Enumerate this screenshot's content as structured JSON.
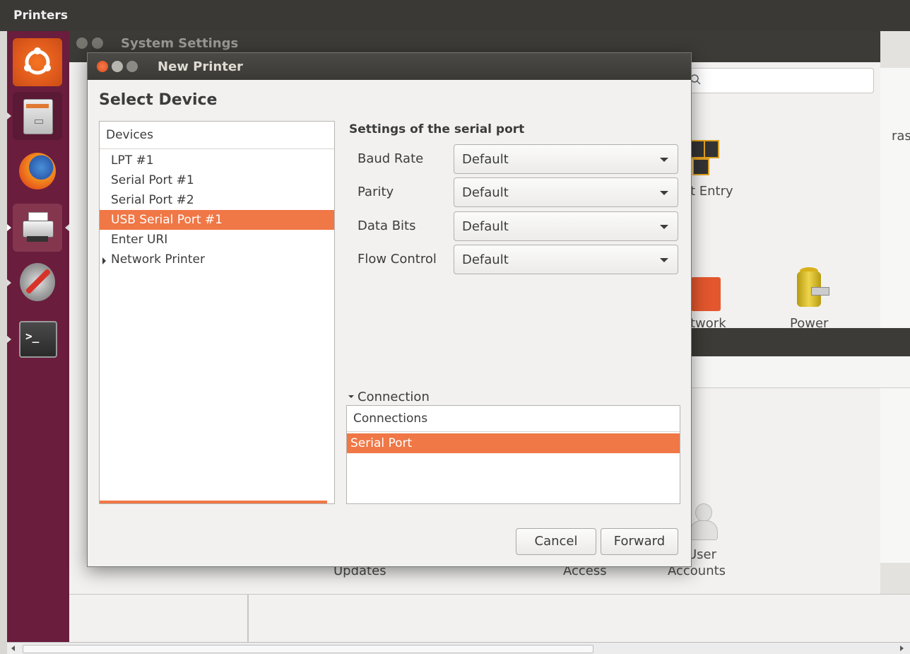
{
  "top_panel": {
    "title": "Printers"
  },
  "launcher": {
    "items": [
      {
        "name": "ubuntu-dash-icon"
      },
      {
        "name": "file-cabinet-icon"
      },
      {
        "name": "firefox-icon"
      },
      {
        "name": "printer-icon"
      },
      {
        "name": "system-settings-icon"
      },
      {
        "name": "terminal-icon"
      }
    ]
  },
  "background": {
    "settings_title": "System Settings",
    "labels": {
      "entry": "t Entry",
      "network": "twork",
      "power": "Power",
      "updates": "Updates",
      "access": "Access",
      "user": "User",
      "accounts": "Accounts",
      "ras": "ras"
    }
  },
  "dialog": {
    "title": "New Printer",
    "heading": "Select Device",
    "devices_header": "Devices",
    "devices": [
      {
        "label": "LPT #1",
        "selected": false,
        "expander": false
      },
      {
        "label": "Serial Port #1",
        "selected": false,
        "expander": false
      },
      {
        "label": "Serial Port #2",
        "selected": false,
        "expander": false
      },
      {
        "label": "USB Serial Port #1",
        "selected": true,
        "expander": false
      },
      {
        "label": "Enter URI",
        "selected": false,
        "expander": false
      },
      {
        "label": "Network Printer",
        "selected": false,
        "expander": true
      }
    ],
    "settings_title": "Settings of the serial port",
    "fields": [
      {
        "label": "Baud Rate",
        "value": "Default"
      },
      {
        "label": "Parity",
        "value": "Default"
      },
      {
        "label": "Data Bits",
        "value": "Default"
      },
      {
        "label": "Flow Control",
        "value": "Default"
      }
    ],
    "connection_label": "Connection",
    "connections_header": "Connections",
    "connections": [
      {
        "label": "Serial Port",
        "selected": true
      }
    ],
    "cancel_label": "Cancel",
    "forward_label": "Forward"
  },
  "colors": {
    "accent": "#f07746",
    "launcher": "#6a1d3c",
    "panel": "#3a3936"
  }
}
